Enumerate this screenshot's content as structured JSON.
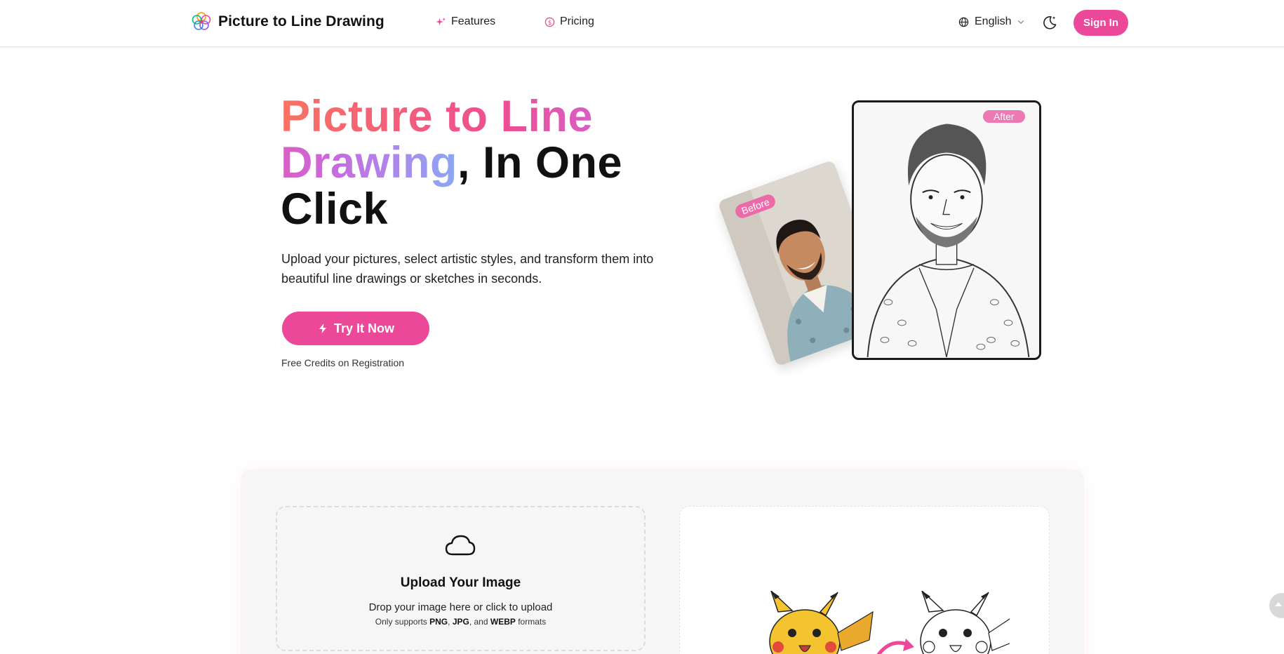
{
  "header": {
    "brand_name": "Picture to Line Drawing",
    "nav": {
      "features": "Features",
      "pricing": "Pricing"
    },
    "language": "English",
    "signin_label": "Sign In"
  },
  "hero": {
    "title_gradient": "Picture to Line Drawing",
    "title_rest": ", In One Click",
    "subtitle": "Upload your pictures, select artistic styles, and transform them into beautiful line drawings or sketches in seconds.",
    "cta_label": "Try It Now",
    "free_credits": "Free Credits on Registration",
    "before_label": "Before",
    "after_label": "After"
  },
  "upload": {
    "title": "Upload Your Image",
    "hint": "Drop your image here or click to upload",
    "formats_prefix": "Only supports ",
    "format_png": "PNG",
    "format_jpg": "JPG",
    "format_and": ", and ",
    "format_webp": "WEBP",
    "formats_suffix": " formats"
  },
  "colors": {
    "accent": "#ec4899",
    "gradient_start": "#f97361",
    "gradient_end": "#8aa9f5"
  },
  "icons": {
    "logo": "flower-logo-icon",
    "features": "sparkles-icon",
    "pricing": "dollar-coin-icon",
    "language": "globe-icon",
    "theme": "moon-sparkle-icon",
    "cta": "lightning-icon",
    "upload": "cloud-icon",
    "scroll": "chevron-up-icon"
  }
}
